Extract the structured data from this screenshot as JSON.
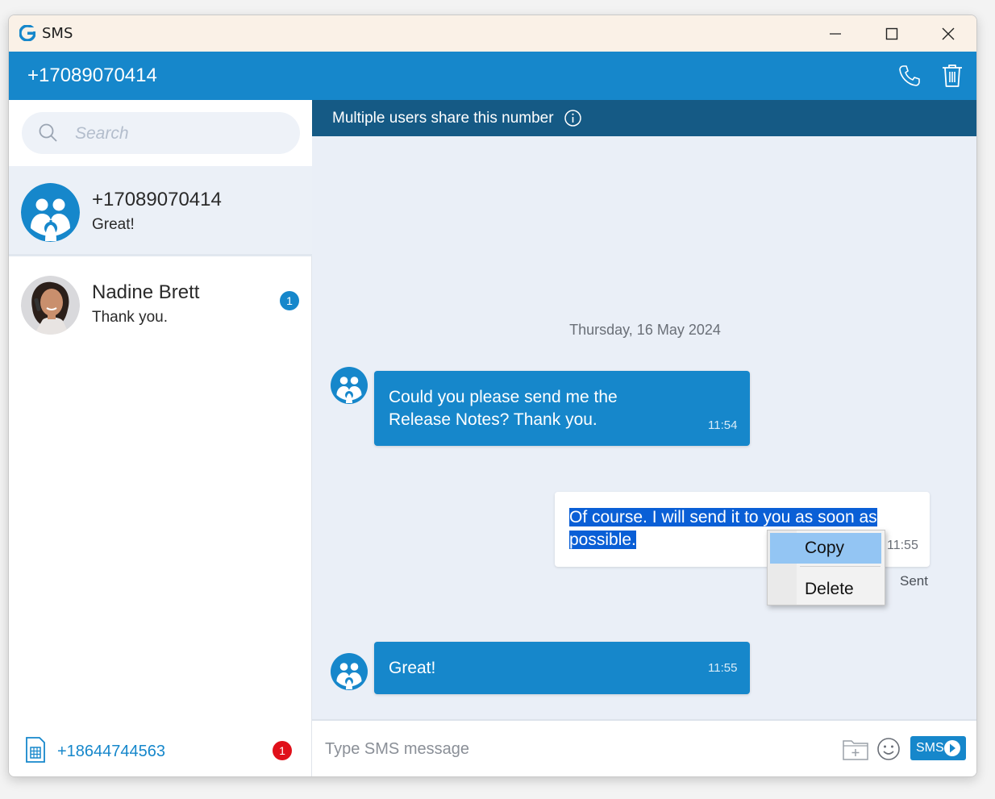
{
  "window": {
    "title": "SMS"
  },
  "header": {
    "number": "+17089070414"
  },
  "search": {
    "placeholder": "Search"
  },
  "conversations": [
    {
      "name": "+17089070414",
      "last_message": "Great!",
      "active": true
    },
    {
      "name": "Nadine Brett",
      "last_message": "Thank you.",
      "unread": "1"
    }
  ],
  "sim": {
    "number": "+18644744563",
    "badge": "1"
  },
  "chat": {
    "notice": "Multiple users share this number",
    "date": "Thursday, 16 May 2024",
    "messages": [
      {
        "direction": "in",
        "text": "Could you please send me the Release Notes? Thank you.",
        "time": "11:54"
      },
      {
        "direction": "out",
        "text": "Of course. I will send it to you as soon as possible.",
        "time": "11:55",
        "status": "Sent"
      },
      {
        "direction": "in",
        "text": "Great!",
        "time": "11:55"
      }
    ],
    "context_menu": {
      "copy": "Copy",
      "delete": "Delete"
    },
    "composer": {
      "placeholder": "Type SMS message",
      "send_label": "SMS"
    }
  },
  "colors": {
    "accent": "#1687cb",
    "notice_bg": "#155a85",
    "badge_red": "#e0101a",
    "selection": "#0a5fd6"
  }
}
